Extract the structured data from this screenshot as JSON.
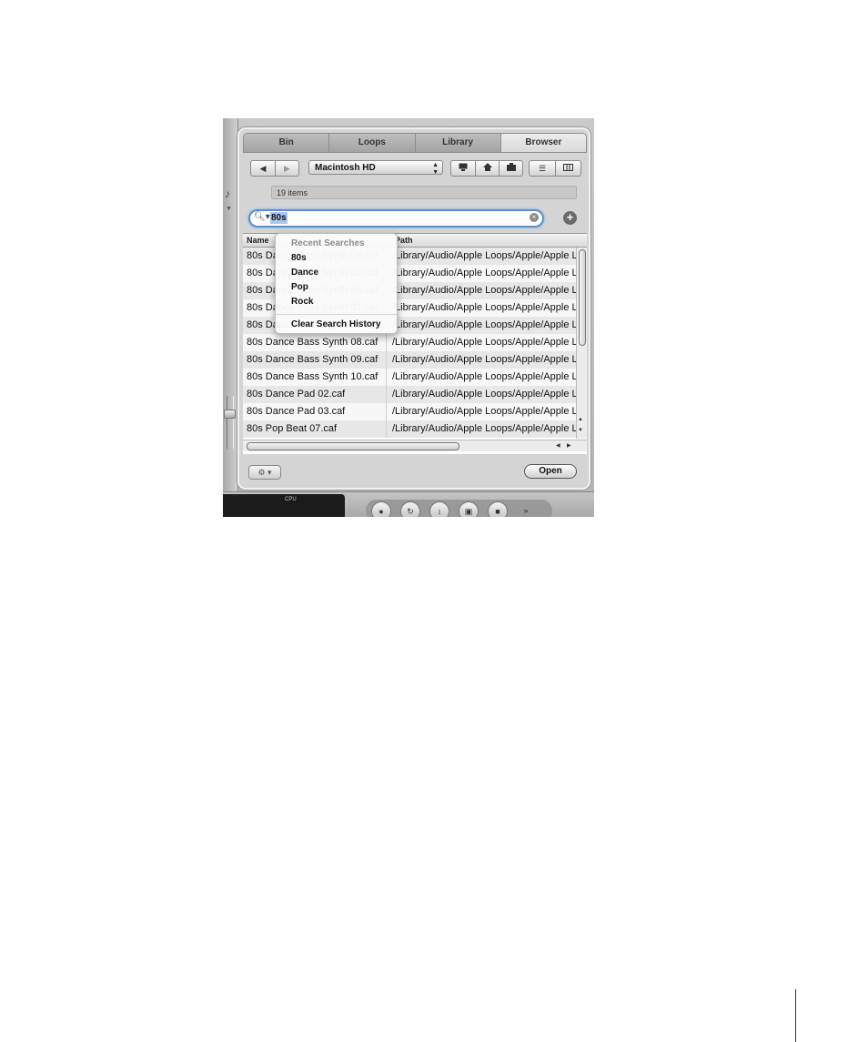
{
  "tabs": [
    {
      "label": "Bin",
      "active": false
    },
    {
      "label": "Loops",
      "active": false
    },
    {
      "label": "Library",
      "active": false
    },
    {
      "label": "Browser",
      "active": true
    }
  ],
  "toolbar": {
    "back_icon": "back-arrow-icon",
    "forward_icon": "forward-arrow-icon",
    "location": "Macintosh HD",
    "icons": [
      "computer-icon",
      "home-icon",
      "project-folder-icon",
      "list-view-icon",
      "column-view-icon"
    ]
  },
  "item_count": "19 items",
  "search": {
    "value": "80s",
    "menu_header": "Recent Searches",
    "recent": [
      "80s",
      "Dance",
      "Pop",
      "Rock"
    ],
    "clear_label": "Clear Search History"
  },
  "table": {
    "columns": [
      "Name",
      "Path"
    ],
    "rows": [
      {
        "name": "80s Dance Bass Synth 04.caf",
        "path": "/Library/Audio/Apple Loops/Apple/Apple Loops for Soundtrack Pro"
      },
      {
        "name": "80s Dance Bass Synth 05.caf",
        "path": "/Library/Audio/Apple Loops/Apple/Apple Loops for Soundtrack Pro"
      },
      {
        "name": "80s Dance Bass Synth 06.caf",
        "path": "/Library/Audio/Apple Loops/Apple/Apple Loops for Soundtrack Pro"
      },
      {
        "name": "80s Dance Bass Synth 07.caf",
        "path": "/Library/Audio/Apple Loops/Apple/Apple Loops for Soundtrack Pro"
      },
      {
        "name": "80s Dance Bass Synth 05.caf",
        "path": "/Library/Audio/Apple Loops/Apple/Apple Loops for Soundtrack Pro"
      },
      {
        "name": "80s Dance Bass Synth 08.caf",
        "path": "/Library/Audio/Apple Loops/Apple/Apple Loops for Soundtrack Pro"
      },
      {
        "name": "80s Dance Bass Synth 09.caf",
        "path": "/Library/Audio/Apple Loops/Apple/Apple Loops for Soundtrack Pro"
      },
      {
        "name": "80s Dance Bass Synth 10.caf",
        "path": "/Library/Audio/Apple Loops/Apple/Apple Loops for Soundtrack Pro"
      },
      {
        "name": "80s Dance Pad 02.caf",
        "path": "/Library/Audio/Apple Loops/Apple/Apple Loops for Soundtrack Pro"
      },
      {
        "name": "80s Dance Pad 03.caf",
        "path": "/Library/Audio/Apple Loops/Apple/Apple Loops for Soundtrack Pro"
      },
      {
        "name": "80s Pop Beat 07.caf",
        "path": "/Library/Audio/Apple Loops/Apple/Apple Loops for Soundtrack Pro"
      }
    ]
  },
  "footer": {
    "action_icon": "gear-icon",
    "open_label": "Open"
  },
  "cpu_label": "CPU"
}
